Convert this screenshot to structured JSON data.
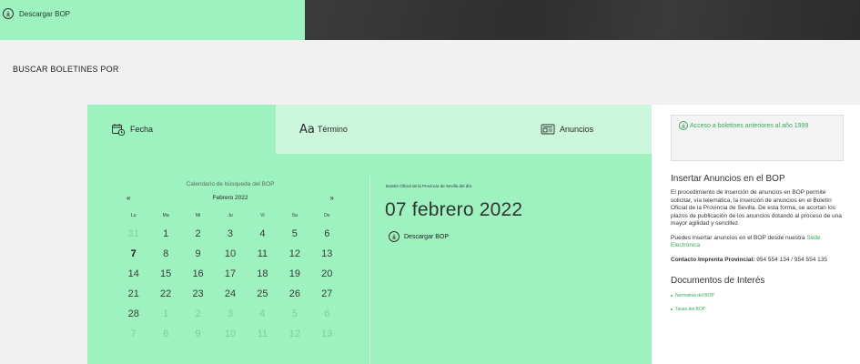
{
  "header": {
    "download_label": "Descargar BOP"
  },
  "search": {
    "title": "BUSCAR BOLETINES POR"
  },
  "tabs": [
    {
      "label": "Fecha"
    },
    {
      "label": "Término"
    },
    {
      "label": "Anuncios"
    }
  ],
  "calendar": {
    "caption": "Calendario de búsqueda del BOP",
    "prev": "«",
    "next": "»",
    "month_label": "Febrero 2022",
    "weekdays": [
      "Lu",
      "Ma",
      "Mi",
      "Ju",
      "Vi",
      "Sa",
      "Do"
    ],
    "days": [
      {
        "n": "31",
        "other": true
      },
      {
        "n": "1"
      },
      {
        "n": "2"
      },
      {
        "n": "3"
      },
      {
        "n": "4"
      },
      {
        "n": "5"
      },
      {
        "n": "6"
      },
      {
        "n": "7",
        "selected": true
      },
      {
        "n": "8"
      },
      {
        "n": "9"
      },
      {
        "n": "10"
      },
      {
        "n": "11"
      },
      {
        "n": "12"
      },
      {
        "n": "13"
      },
      {
        "n": "14"
      },
      {
        "n": "15"
      },
      {
        "n": "16"
      },
      {
        "n": "17"
      },
      {
        "n": "18"
      },
      {
        "n": "19"
      },
      {
        "n": "20"
      },
      {
        "n": "21"
      },
      {
        "n": "22"
      },
      {
        "n": "23"
      },
      {
        "n": "24"
      },
      {
        "n": "25"
      },
      {
        "n": "26"
      },
      {
        "n": "27"
      },
      {
        "n": "28"
      },
      {
        "n": "1",
        "other": true
      },
      {
        "n": "2",
        "other": true
      },
      {
        "n": "3",
        "other": true
      },
      {
        "n": "4",
        "other": true
      },
      {
        "n": "5",
        "other": true
      },
      {
        "n": "6",
        "other": true
      },
      {
        "n": "7",
        "other": true
      },
      {
        "n": "8",
        "other": true
      },
      {
        "n": "9",
        "other": true
      },
      {
        "n": "10",
        "other": true
      },
      {
        "n": "11",
        "other": true
      },
      {
        "n": "12",
        "other": true
      },
      {
        "n": "13",
        "other": true
      }
    ]
  },
  "bulletin": {
    "subtitle": "Boletín Oficial de la Provincia de Sevilla del día",
    "date": "07 febrero 2022",
    "download_label": "Descargar BOP"
  },
  "sidebar": {
    "archive_link": "Acceso a boletines anteriores al año 1999",
    "insert_title": "Insertar Anuncios en el BOP",
    "insert_text": "El procedimiento de Inserción de anuncios en BOP permite solicitar, vía telemática, la inserción de anuncios en el Boletín Oficial de la Provincia de Sevilla. De esta forma, se acortan los plazos de publicación de los anuncios dotando al proceso de una mayor agilidad y sencillez.",
    "insert_online_prefix": "Puedes insertar anuncios en el BOP desde nuestra",
    "insert_online_link": "Sede Electrónica",
    "contact_label": "Contacto Imprenta Provincial:",
    "contact_value": "954 554 134 / 954 554 135",
    "docs_title": "Documentos de Interés",
    "docs": [
      {
        "label": "Normativa del BOP"
      },
      {
        "label": "Tasas del BOP"
      }
    ]
  },
  "colors": {
    "accent_green": "#9ef2bf",
    "tab_inactive": "#ccf7dc",
    "link_green": "#37a85c"
  }
}
